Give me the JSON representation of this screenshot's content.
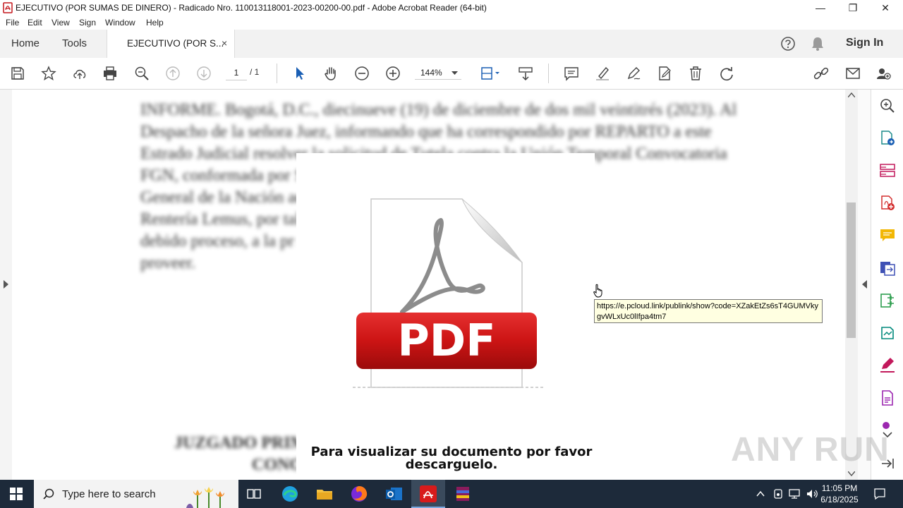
{
  "window": {
    "title": "EJECUTIVO (POR SUMAS DE DINERO) - Radicado Nro. 110013118001-2023-00200-00.pdf - Adobe Acrobat Reader (64-bit)",
    "controls": {
      "minimize": "—",
      "maximize": "❐",
      "close": "✕"
    }
  },
  "menu": [
    "File",
    "Edit",
    "View",
    "Sign",
    "Window",
    "Help"
  ],
  "tabs": {
    "home": "Home",
    "tools": "Tools",
    "document": "EJECUTIVO (POR S...",
    "close": "×"
  },
  "header_right": {
    "sign_in": "Sign In"
  },
  "toolbar": {
    "page_current": "1",
    "page_total": "/ 1",
    "zoom": "144%"
  },
  "document": {
    "blurred_paragraph": [
      "INFORME. Bogotá, D.C., diecinueve (19) de diciembre de dos mil veintitrés (2023). Al",
      "Despacho de la señora Juez, informando que ha correspondido por REPARTO a este",
      "Estrado Judicial resolver la solicitud de Tutela contra la Unión Temporal Convocatoria",
      "FGN, conformada por                                                        S.A.S., y la Fiscalía",
      "General de la Nación                                                    adana Ruby Lorena",
      "Rentería Lemus, por                                                    tales a la igualdad,",
      "debido proceso, a la pr                                                 s públicos. Sírvase",
      "proveer."
    ],
    "blurred_footer": [
      "JUZGADO PRIMI                                        FUNCIÓN DE",
      "CONO                                                  D.C."
    ],
    "pdf_badge": "PDF",
    "download_message": "Para visualizar su documento por favor descarguelo."
  },
  "tooltip": {
    "url": "https://e.pcloud.link/publink/show?code=XZakEtZs6sT4GUMVkygvWLxUc0lIfpa4tm7"
  },
  "watermark": "ANY RUN",
  "taskbar": {
    "search_placeholder": "Type here to search",
    "time": "11:05 PM",
    "date": "6/18/2025"
  },
  "colors": {
    "acrobat_red": "#c4161c",
    "pdf_red": "#d01a1a",
    "taskbar": "#1d2a3a",
    "tooltip_bg": "#ffffe1"
  }
}
